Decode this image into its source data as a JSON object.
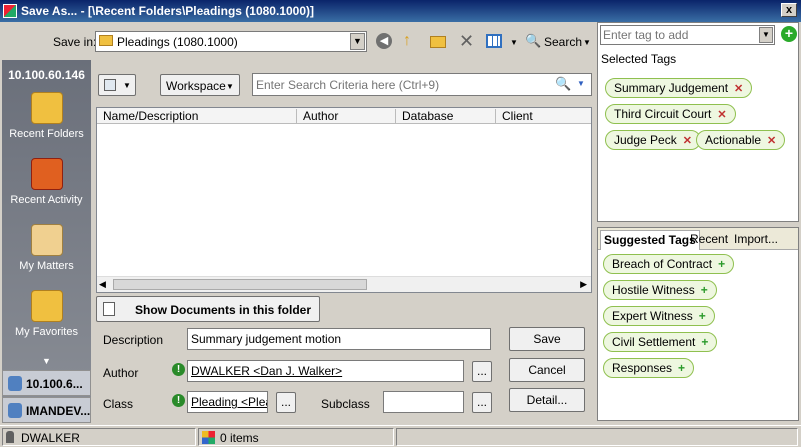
{
  "window": {
    "title": "Save As... - [\\Recent Folders\\Pleadings (1080.1000)]",
    "close_glyph": "x"
  },
  "toolbar": {
    "save_in_label": "Save in:",
    "save_in_value": "Pleadings (1080.1000)",
    "search_label": "Search"
  },
  "sidebar": {
    "server": "10.100.60.146",
    "items": [
      {
        "label": "Recent Folders"
      },
      {
        "label": "Recent Activity"
      },
      {
        "label": "My Matters"
      },
      {
        "label": "My Favorites"
      }
    ],
    "db_items": [
      {
        "label": "10.100.6..."
      },
      {
        "label": "IMANDEV..."
      }
    ]
  },
  "browser": {
    "workspace_label": "Workspace",
    "search_placeholder": "Enter Search Criteria here (Ctrl+9)",
    "columns": [
      "Name/Description",
      "Author",
      "Database",
      "Client"
    ],
    "show_docs_label": "Show Documents in this folder"
  },
  "form": {
    "description_label": "Description",
    "description_value": "Summary judgement motion",
    "author_label": "Author",
    "author_value": "DWALKER <Dan J. Walker>",
    "class_label": "Class",
    "class_value": "Pleading <Plead",
    "subclass_label": "Subclass",
    "subclass_value": "",
    "ellipsis": "...",
    "save_label": "Save",
    "cancel_label": "Cancel",
    "detail_label": "Detail..."
  },
  "tags": {
    "add_placeholder": "Enter tag to add",
    "selected_heading": "Selected Tags",
    "selected": [
      "Summary Judgement",
      "Third Circuit Court",
      "Judge Peck",
      "Actionable"
    ],
    "tabs": [
      "Suggested Tags",
      "Recent",
      "Import..."
    ],
    "suggested": [
      "Breach of Contract",
      "Hostile Witness",
      "Expert Witness",
      "Civil Settlement",
      "Responses"
    ]
  },
  "status": {
    "user": "DWALKER",
    "items": "0 items"
  },
  "colors": {
    "titlebar": "#0a246a",
    "tag_border": "#8fc04f",
    "tag_fill": "#eef7e0",
    "remove": "#c03030",
    "add": "#2a9a2a"
  }
}
